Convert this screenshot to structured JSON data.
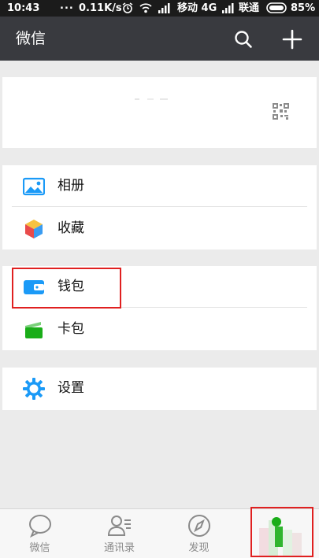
{
  "status_bar": {
    "time": "10:43",
    "dots": "...",
    "speed": "0.11K/s",
    "carrier1": "移动 4G",
    "carrier2": "联通",
    "battery": "85%"
  },
  "header": {
    "title": "微信",
    "icons": [
      "search-icon",
      "plus-icon"
    ]
  },
  "menu": {
    "album": "相册",
    "favorites": "收藏",
    "wallet": "钱包",
    "cards": "卡包",
    "settings": "设置"
  },
  "tabs": [
    {
      "label": "微信",
      "icon": "chat-icon"
    },
    {
      "label": "通讯录",
      "icon": "contacts-icon"
    },
    {
      "label": "发现",
      "icon": "compass-icon"
    }
  ],
  "colors": {
    "accent": "#1aad19",
    "header_bg": "#393a3f",
    "icon_blue": "#1b9af7",
    "highlight": "#e02020"
  }
}
